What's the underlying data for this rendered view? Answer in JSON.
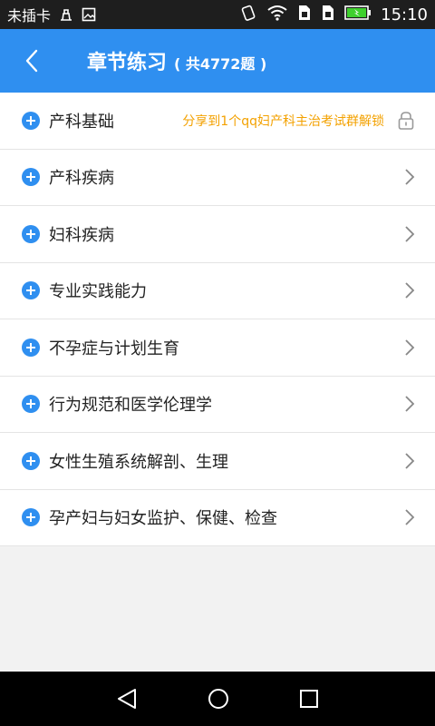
{
  "status_bar": {
    "carrier": "未插卡",
    "time": "15:10",
    "icons": [
      "usb-icon",
      "image-icon",
      "nfc-icon",
      "wifi-icon",
      "sim1-icon",
      "sim2-icon",
      "battery-icon"
    ]
  },
  "header": {
    "title": "章节练习",
    "count": "( 共4772题 )",
    "color": "#2f8ff0"
  },
  "chapters": [
    {
      "label": "产科基础",
      "share_text": "分享到1个qq妇产科主治考试群解锁",
      "locked": true
    },
    {
      "label": "产科疾病",
      "locked": false
    },
    {
      "label": "妇科疾病",
      "locked": false
    },
    {
      "label": "专业实践能力",
      "locked": false
    },
    {
      "label": "不孕症与计划生育",
      "locked": false
    },
    {
      "label": "行为规范和医学伦理学",
      "locked": false
    },
    {
      "label": "女性生殖系统解剖、生理",
      "locked": false
    },
    {
      "label": "孕产妇与妇女监护、保健、检查",
      "locked": false
    }
  ],
  "colors": {
    "accent": "#2f8ff0",
    "share": "#f3a100"
  }
}
